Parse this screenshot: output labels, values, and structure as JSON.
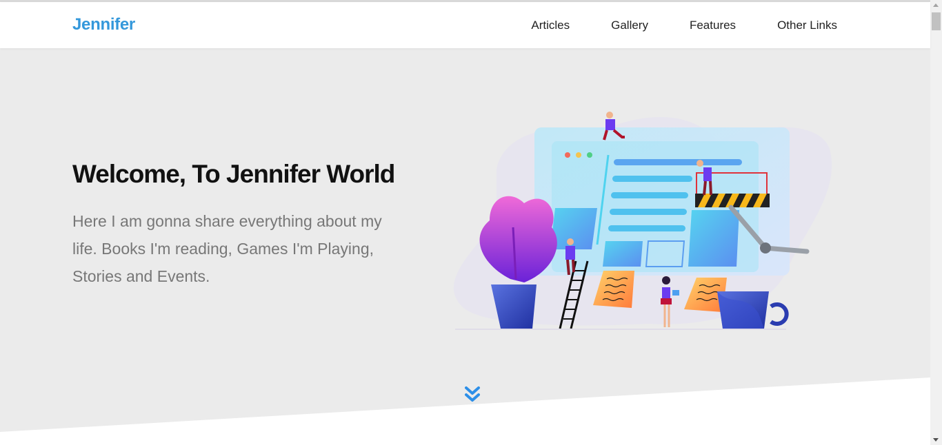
{
  "brand": {
    "name": "Jennifer",
    "color": "#3498db"
  },
  "nav": {
    "items": [
      {
        "label": "Articles"
      },
      {
        "label": "Gallery"
      },
      {
        "label": "Features"
      },
      {
        "label": "Other Links"
      }
    ]
  },
  "hero": {
    "title": "Welcome, To Jennifer World",
    "text": "Here I am gonna share everything about my life. Books I'm reading, Games I'm Playing, Stories and Events.",
    "background": "#ebebeb",
    "illustration_icon": "web-design-team-illustration",
    "scroll_icon": "double-chevron-down-icon"
  }
}
